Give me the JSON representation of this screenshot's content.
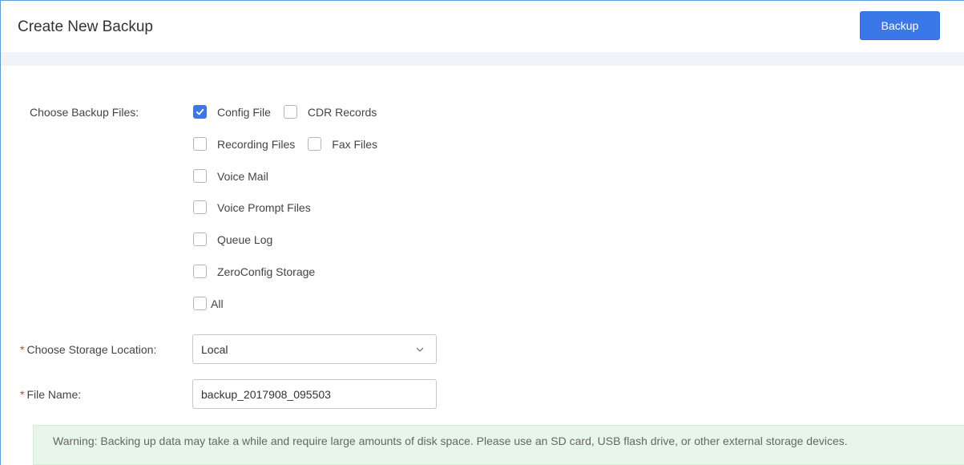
{
  "header": {
    "title": "Create New Backup",
    "backup_label": "Backup"
  },
  "form": {
    "backup_files": {
      "label": "Choose Backup Files:",
      "options": [
        {
          "label": "Config File",
          "checked": true
        },
        {
          "label": "CDR Records",
          "checked": false
        },
        {
          "label": "Recording Files",
          "checked": false
        },
        {
          "label": "Fax Files",
          "checked": false
        },
        {
          "label": "Voice Mail",
          "checked": false
        },
        {
          "label": "Voice Prompt Files",
          "checked": false
        },
        {
          "label": "Queue Log",
          "checked": false
        },
        {
          "label": "ZeroConfig Storage",
          "checked": false
        },
        {
          "label": "All",
          "checked": false
        }
      ]
    },
    "storage": {
      "required_mark": "*",
      "label": "Choose Storage Location:",
      "value": "Local"
    },
    "file_name": {
      "required_mark": "*",
      "label": "File Name:",
      "value": "backup_2017908_095503"
    }
  },
  "warning": {
    "text": "Warning: Backing up data may take a while and require large amounts of disk space. Please use an SD card, USB flash drive, or other external storage devices."
  },
  "colors": {
    "accent": "#3b78e7",
    "required": "#e0302d",
    "warning_bg": "#e8f5e9"
  }
}
